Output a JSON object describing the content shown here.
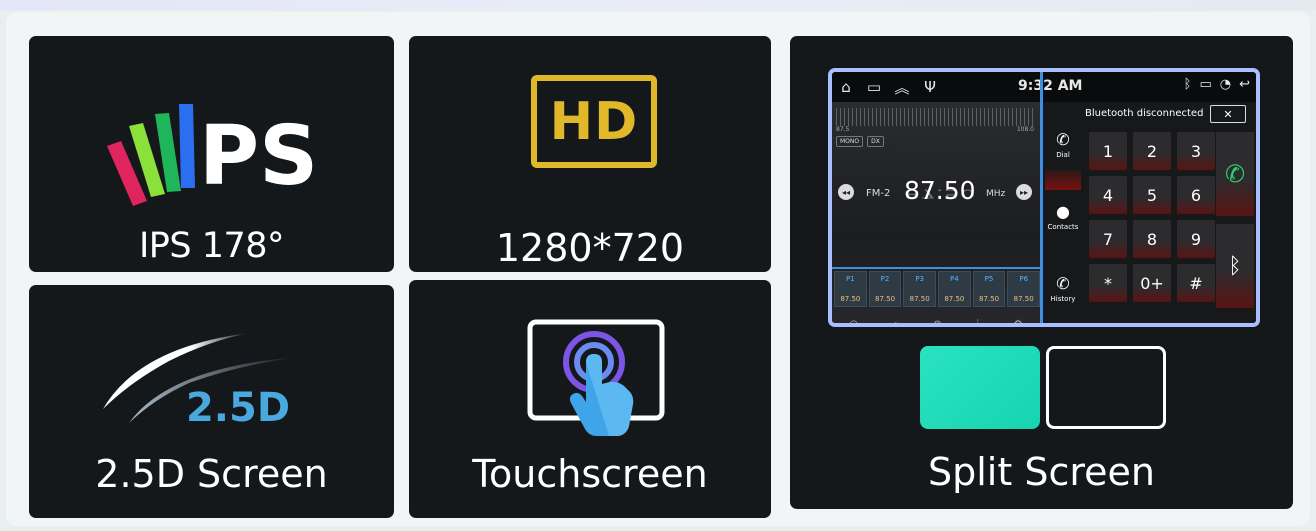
{
  "features": {
    "ips": {
      "label": "IPS 178°",
      "logo_text": "PS"
    },
    "hd": {
      "label": "1280*720",
      "badge_text": "HD"
    },
    "d25": {
      "label": "2.5D Screen",
      "badge_text": "2.5D"
    },
    "touch": {
      "label": "Touchscreen"
    },
    "split": {
      "label": "Split Screen"
    }
  },
  "screen": {
    "status": {
      "time": "9:32 AM",
      "left_icons": [
        "home-icon",
        "window-icon",
        "chevron-up-double-icon",
        "usb-icon"
      ],
      "right_icons": [
        "bluetooth-icon",
        "battery-icon",
        "wifi-icon",
        "back-icon"
      ]
    },
    "radio": {
      "tuner_start": "87.5",
      "tuner_end": "108.0",
      "mode_chips": [
        "MONO",
        "DX"
      ],
      "band": "FM-2",
      "frequency": "87.50",
      "unit": "MHz",
      "presets": [
        {
          "name": "P1",
          "freq": "87.50"
        },
        {
          "name": "P2",
          "freq": "87.50"
        },
        {
          "name": "P3",
          "freq": "87.50"
        },
        {
          "name": "P4",
          "freq": "87.50"
        },
        {
          "name": "P5",
          "freq": "87.50"
        },
        {
          "name": "P6",
          "freq": "87.50"
        }
      ]
    },
    "phone": {
      "bt_status": "Bluetooth disconnected",
      "side": [
        {
          "label": "Dial"
        },
        {
          "label": "Contacts"
        },
        {
          "label": "History"
        }
      ],
      "keys": [
        "1",
        "2",
        "3",
        "4",
        "5",
        "6",
        "7",
        "8",
        "9",
        "*",
        "0+",
        "#"
      ]
    }
  },
  "colors": {
    "card_bg": "#15181b",
    "hd_gold": "#e0b82a",
    "d25_blue": "#49a8dd",
    "split_teal": "#29e3c0",
    "screen_border": "#a9bfff",
    "call_green": "#2fd16f"
  }
}
